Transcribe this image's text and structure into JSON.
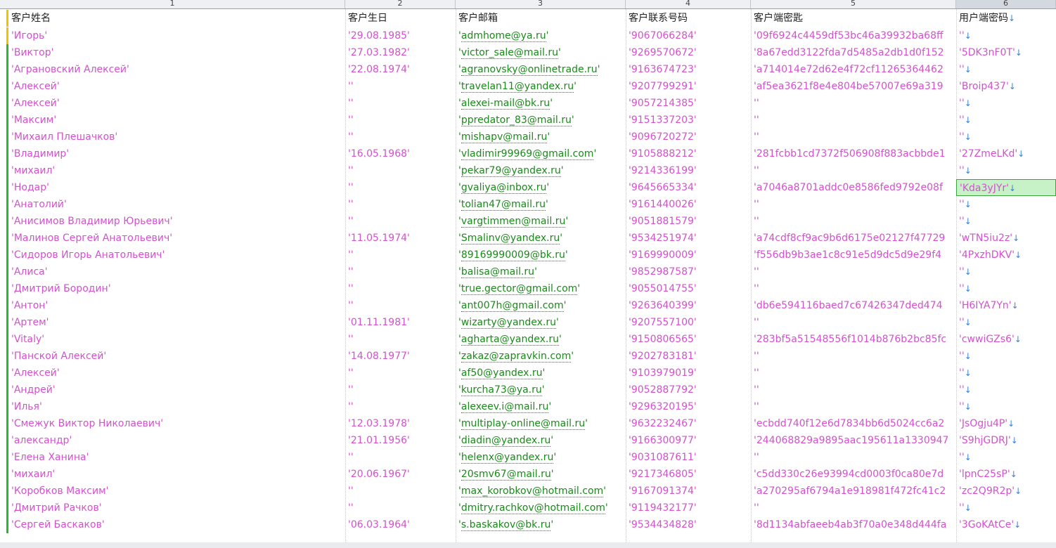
{
  "column_numbers": [
    "1",
    "2",
    "3",
    "4",
    "5",
    "6"
  ],
  "headers": {
    "name": "客户姓名",
    "birthday": "客户生日",
    "email": "客户邮箱",
    "phone": "客户联系号码",
    "client_key": "客户端密匙",
    "user_password": "用户端密码"
  },
  "arrow_glyph": "↓",
  "rows": [
    {
      "name": "'Игорь'",
      "birthday": "'29.08.1985'",
      "email": "admhome@ya.ru",
      "phone": "'9067066284'",
      "client_key": "'09f6924c4459df53bc46a39932ba68ff",
      "user_password": "''"
    },
    {
      "name": "'Виктор'",
      "birthday": "'27.03.1982'",
      "email": "victor_sale@mail.ru",
      "phone": "'9269570672'",
      "client_key": "'8a67edd3122fda7d5485a2db1d0f152",
      "user_password": "'5DK3nF0T'"
    },
    {
      "name": "'Аграновский Алексей'",
      "birthday": "'22.08.1974'",
      "email": "agranovsky@onlinetrade.ru",
      "phone": "'9163674723'",
      "client_key": "'a714014e72d62e4f72cf11265364462",
      "user_password": "''"
    },
    {
      "name": "'Алексей'",
      "birthday": "''",
      "email": "travelan11@yandex.ru",
      "phone": "'9207799291'",
      "client_key": "'af5ea3621f8e4e804be57007e69a319",
      "user_password": "'Broip437'"
    },
    {
      "name": "'Алексей'",
      "birthday": "''",
      "email": "alexei-mail@bk.ru",
      "phone": "'9057214385'",
      "client_key": "''",
      "user_password": "''"
    },
    {
      "name": "'Максим'",
      "birthday": "''",
      "email": "ppredator_83@mail.ru",
      "phone": "'9151337203'",
      "client_key": "''",
      "user_password": "''"
    },
    {
      "name": "'Михаил Плешачков'",
      "birthday": "''",
      "email": "mishapv@mail.ru",
      "phone": "'9096720272'",
      "client_key": "''",
      "user_password": "''"
    },
    {
      "name": "'Владимир'",
      "birthday": "'16.05.1968'",
      "email": "vladimir99969@gmail.com",
      "phone": "'9105888212'",
      "client_key": "'281fcbb1cd7372f506908f883acbbde1",
      "user_password": "'27ZmeLKd'"
    },
    {
      "name": "'михаил'",
      "birthday": "''",
      "email": "pekar79@yandex.ru",
      "phone": "'9214336199'",
      "client_key": "''",
      "user_password": "''"
    },
    {
      "name": "'Нодар'",
      "birthday": "''",
      "email": "gvaliya@inbox.ru",
      "phone": "'9645665334'",
      "client_key": "'a7046a8701addc0e8586fed9792e08f",
      "user_password": "'Kda3yJYr'"
    },
    {
      "name": "'Анатолий'",
      "birthday": "''",
      "email": "tolian47@mail.ru",
      "phone": "'9161440026'",
      "client_key": "''",
      "user_password": "''"
    },
    {
      "name": "'Анисимов Владимир Юрьевич'",
      "birthday": "''",
      "email": "vargtimmen@mail.ru",
      "phone": "'9051881579'",
      "client_key": "''",
      "user_password": "''"
    },
    {
      "name": "'Малинов Сергей Анатольевич'",
      "birthday": "'11.05.1974'",
      "email": "Smalinv@yandex.ru",
      "phone": "'9534251974'",
      "client_key": "'a74cdf8cf9ac9b6d6175e02127f47729",
      "user_password": "'wTN5iu2z'"
    },
    {
      "name": "'Сидоров Игорь Анатольевич'",
      "birthday": "''",
      "email": "89169990009@bk.ru",
      "phone": "'9169990009'",
      "client_key": "'f556db9b3ae1c8c91e5d9dc5d9e29f4",
      "user_password": "'4PxzhDKV'"
    },
    {
      "name": "'Алиса'",
      "birthday": "''",
      "email": "balisa@mail.ru",
      "phone": "'9852987587'",
      "client_key": "''",
      "user_password": "''"
    },
    {
      "name": "'Дмитрий Бородин'",
      "birthday": "''",
      "email": "true.gector@gmail.com",
      "phone": "'9055014755'",
      "client_key": "''",
      "user_password": "''"
    },
    {
      "name": "'Антон'",
      "birthday": "''",
      "email": "ant007h@gmail.com",
      "phone": "'9263640399'",
      "client_key": "'db6e594116baed7c67426347ded474",
      "user_password": "'H6IYA7Yn'"
    },
    {
      "name": "'Артем'",
      "birthday": "'01.11.1981'",
      "email": "wizarty@yandex.ru",
      "phone": "'9207557100'",
      "client_key": "''",
      "user_password": "''"
    },
    {
      "name": "'Vitaly'",
      "birthday": "''",
      "email": "agharta@yandex.ru",
      "phone": "'9150806565'",
      "client_key": "'283bf5a51548556f1014b876b2bc85fc",
      "user_password": "'cwwiGZs6'"
    },
    {
      "name": "'Панской Алексей'",
      "birthday": "'14.08.1977'",
      "email": "zakaz@zapravkin.com",
      "phone": "'9202783181'",
      "client_key": "''",
      "user_password": "''"
    },
    {
      "name": "'Алексей'",
      "birthday": "''",
      "email": "af50@yandex.ru",
      "phone": "'9103979019'",
      "client_key": "''",
      "user_password": "''"
    },
    {
      "name": "'Андрей'",
      "birthday": "''",
      "email": "kurcha73@ya.ru",
      "phone": "'9052887792'",
      "client_key": "''",
      "user_password": "''"
    },
    {
      "name": "'Илья'",
      "birthday": "''",
      "email": "alexeev.i@mail.ru",
      "phone": "'9296320195'",
      "client_key": "''",
      "user_password": "''"
    },
    {
      "name": "'Смежук Виктор Николаевич'",
      "birthday": "'12.03.1978'",
      "email": "multiplay-online@mail.ru",
      "phone": "'9632232467'",
      "client_key": "'ecbdd740f12e6d7834bb6d5024cc6a2",
      "user_password": "'JsOgju4P'"
    },
    {
      "name": "'александр'",
      "birthday": "'21.01.1956'",
      "email": "diadin@yandex.ru",
      "phone": "'9166300977'",
      "client_key": "'244068829a9895aac195611a1330947",
      "user_password": "'S9hjGDRJ'"
    },
    {
      "name": "'Елена Ханина'",
      "birthday": "''",
      "email": "helenx@yandex.ru",
      "phone": "'9031087611'",
      "client_key": "''",
      "user_password": "''"
    },
    {
      "name": "'михаил'",
      "birthday": "'20.06.1967'",
      "email": "20smv67@mail.ru",
      "phone": "'9217346805'",
      "client_key": "'c5dd330c26e93994cd0003f0ca80e7d",
      "user_password": "'lpnC25sP'"
    },
    {
      "name": "'Коробков Максим'",
      "birthday": "''",
      "email": "max_korobkov@hotmail.com",
      "phone": "'9167091374'",
      "client_key": "'a270295af6794a1e918981f472fc41c2",
      "user_password": "'zc2Q9R2p'"
    },
    {
      "name": "'Дмитрий Рачков'",
      "birthday": "''",
      "email": "dmitry.rachkov@hotmail.com",
      "phone": "'9119432177'",
      "client_key": "''",
      "user_password": "''"
    },
    {
      "name": "'Сергей Баскаков'",
      "birthday": "'06.03.1964'",
      "email": "s.baskakov@bk.ru",
      "phone": "'9534434828'",
      "client_key": "'8d1134abfaeeb4ab3f70a0e348d444fa",
      "user_password": "'3GoKAtCe'"
    }
  ]
}
